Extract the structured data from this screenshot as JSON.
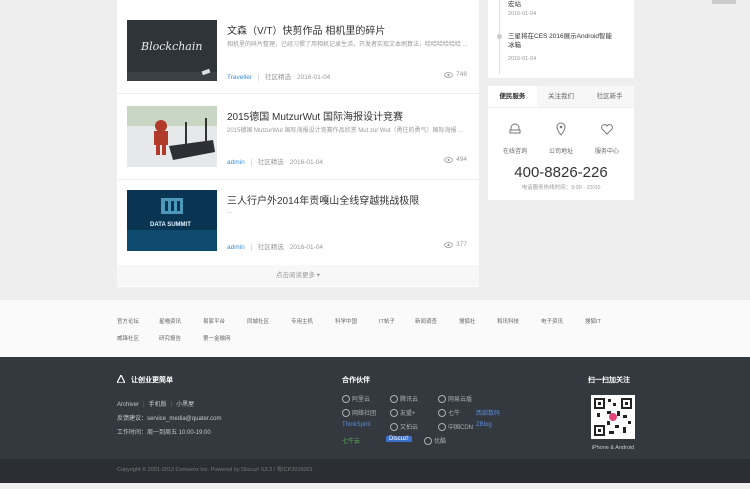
{
  "articles": [
    {
      "title": "文森（V/T）快剪作品 相机里的碎片",
      "desc": "相机里的碎片整理，已经习惯了用相机记录生活，开发者实现文本刷算法，哈哈哈哈哈哈 ...",
      "author": "Traveller",
      "category": "社区精选",
      "date": "2016-01-04",
      "views": "748"
    },
    {
      "title": "2015德国 MutzurWut 国际海报设计竞赛",
      "desc": "2015德国 MutzurWut 国际海报设计竞赛作品欣赏 Mut zur Wut（勇往的勇气）国际海报 ...",
      "author": "admin",
      "category": "社区精选",
      "date": "2016-01-04",
      "views": "494"
    },
    {
      "title": "三人行户外2014年贡嘎山全线穿越挑战极限",
      "desc": "...",
      "author": "admin",
      "category": "社区精选",
      "date": "2016-01-04",
      "views": "377"
    }
  ],
  "thumb_texts": {
    "blockchain": "Blockchain",
    "data_summit": "DATA SUMMIT"
  },
  "load_more": "点击阅读更多 ▾",
  "timeline": [
    {
      "text": "宏站",
      "date": "2016-01-04"
    },
    {
      "text": "三星将在CES 2016展示Android智能冰箱",
      "date": "2016-01-04"
    }
  ],
  "side_tabs": [
    "便民服务",
    "关注我们",
    "社区新手"
  ],
  "services": [
    {
      "icon": "chat-icon",
      "label": "在线咨询"
    },
    {
      "icon": "location-icon",
      "label": "公司地址"
    },
    {
      "icon": "heart-icon",
      "label": "服务中心"
    }
  ],
  "phone": "400-8826-226",
  "phone_sub": "电话服务热线时间：9:00 - 23:00",
  "friend_links": [
    "官方论坛",
    "星喵资讯",
    "易家平台",
    "同城社区",
    "专用主机",
    "科学中国",
    "IT帖子",
    "新闻调查",
    "搜狐社",
    "和讯科技",
    "电子资讯",
    "搜狐IT",
    "威锋社区",
    "研究报告",
    "第一金融网"
  ],
  "footer": {
    "brand_title": "让创业更简单",
    "links": [
      "Archiver",
      "手机版",
      "小黑屋"
    ],
    "email_label": "反馈建议：service_media@quater.com",
    "hours": "工作时间：周一到周五 10:00-19:00",
    "partners_title": "合作伙伴",
    "partners": [
      "阿里云",
      "腾讯云",
      "网易云盾",
      "网络社团",
      "友盟+",
      "七牛",
      "西部数码",
      "ThinkSpirit",
      "又拍云",
      "中国CDN",
      "ZBlog",
      "七牛云",
      "Discuz!",
      "优酷"
    ],
    "qr_title": "扫一扫加关注",
    "qr_caption": "iPhone & Android",
    "copyright": "Copyright © 2001-2013 Comsenz Inc.  Powered by Discuz! X3.3  / 粤ICP2016001"
  }
}
